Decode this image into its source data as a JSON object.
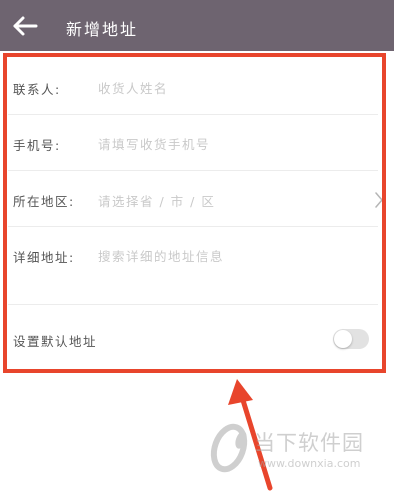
{
  "header": {
    "title": "新增地址",
    "back_icon": "back-arrow-icon"
  },
  "form": {
    "contact": {
      "label": "联系人:",
      "placeholder": "收货人姓名"
    },
    "phone": {
      "label": "手机号:",
      "placeholder": "请填写收货手机号"
    },
    "region": {
      "label": "所在地区:",
      "placeholder": "请选择省 / 市 / 区",
      "chevron_icon": "chevron-right-icon"
    },
    "detail": {
      "label": "详细地址:",
      "placeholder": "搜索详细的地址信息"
    },
    "default": {
      "label": "设置默认地址",
      "toggle_on": false
    }
  },
  "watermark": {
    "name": "当下软件园",
    "url": "www.downxia.com"
  },
  "colors": {
    "header_bg": "#6e6470",
    "highlight": "#e8452c",
    "placeholder": "#c9c9c9"
  }
}
